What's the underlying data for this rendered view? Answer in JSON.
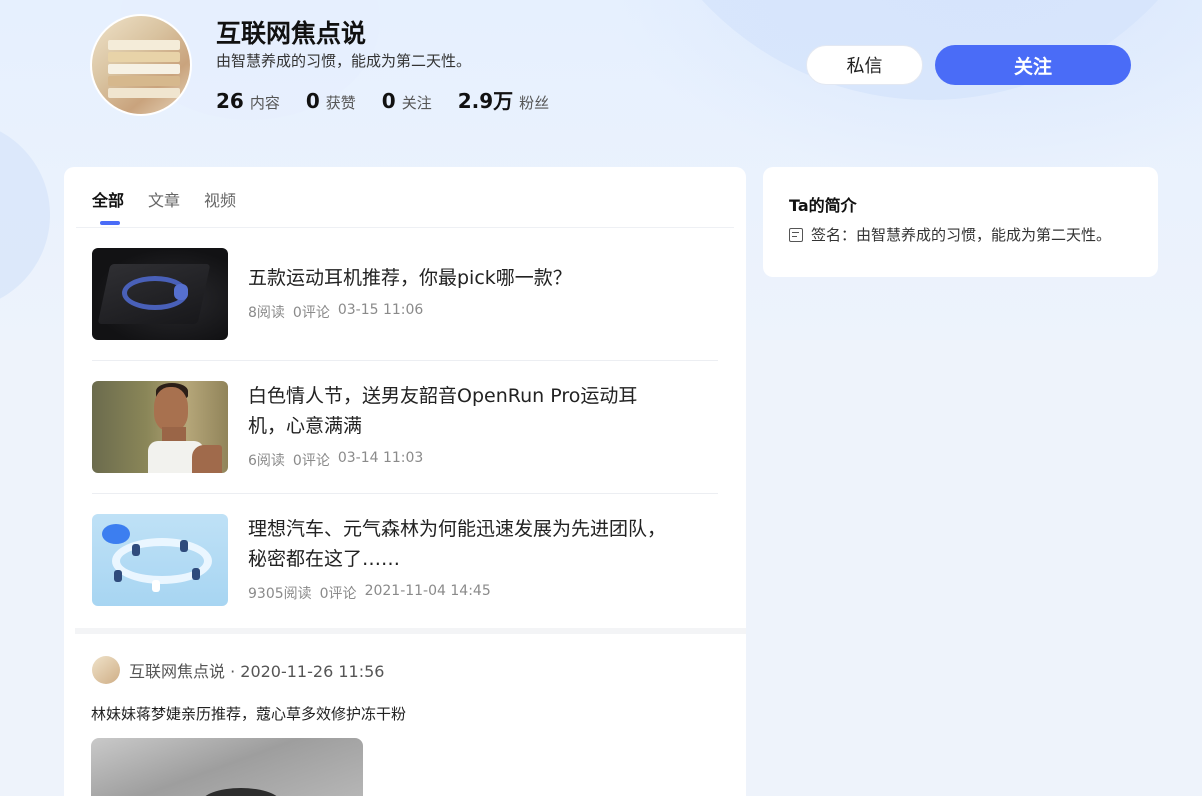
{
  "profile": {
    "name": "互联网焦点说",
    "signature": "由智慧养成的习惯，能成为第二天性。",
    "stats": [
      {
        "num": "26",
        "label": "内容"
      },
      {
        "num": "0",
        "label": "获赞"
      },
      {
        "num": "0",
        "label": "关注"
      },
      {
        "num": "2.9万",
        "label": "粉丝"
      }
    ]
  },
  "actions": {
    "message_label": "私信",
    "follow_label": "关注"
  },
  "tabs": [
    {
      "label": "全部",
      "active": true
    },
    {
      "label": "文章",
      "active": false
    },
    {
      "label": "视频",
      "active": false
    }
  ],
  "articles": [
    {
      "title": "五款运动耳机推荐，你最pick哪一款？",
      "reads": "8阅读",
      "comments": "0评论",
      "time": "03-15 11:06"
    },
    {
      "title": "白色情人节，送男友韶音OpenRun Pro运动耳机，心意满满",
      "reads": "6阅读",
      "comments": "0评论",
      "time": "03-14 11:03"
    },
    {
      "title": "理想汽车、元气森林为何能迅速发展为先进团队，秘密都在这了……",
      "reads": "9305阅读",
      "comments": "0评论",
      "time": "2021-11-04 14:45"
    }
  ],
  "post": {
    "author_line": "互联网焦点说 · 2020-11-26 11:56",
    "text": "林妹妹蒋梦婕亲历推荐，蔻心草多效修护冻干粉"
  },
  "intro": {
    "title": "Ta的简介",
    "sign_text": "签名：由智慧养成的习惯，能成为第二天性。"
  }
}
